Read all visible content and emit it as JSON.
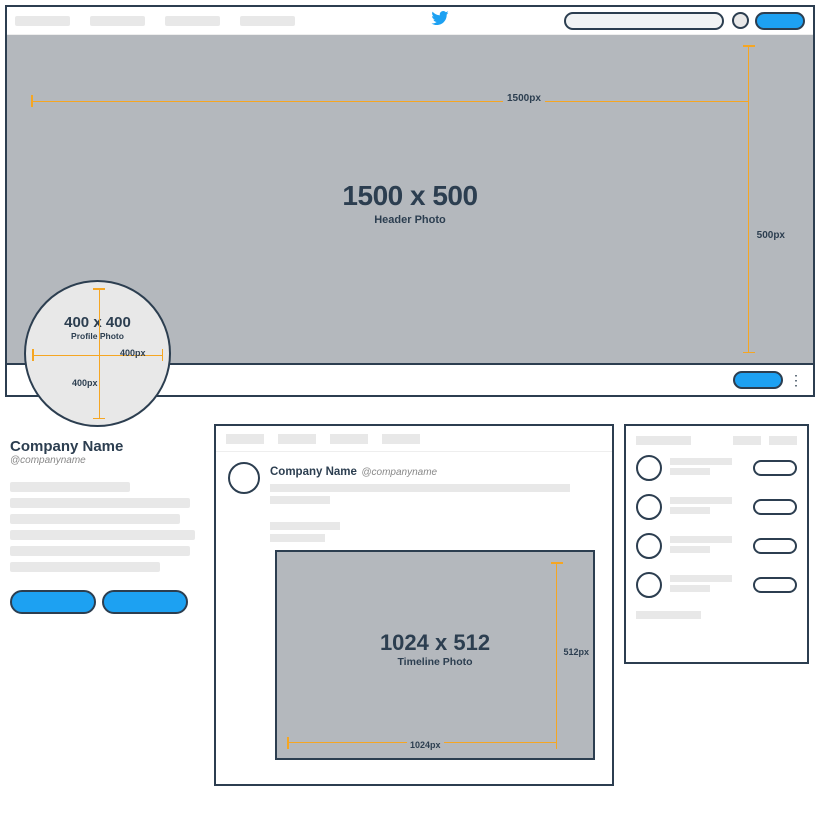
{
  "brand": "twitter",
  "header": {
    "size_label": "1500 x 500",
    "subtitle": "Header Photo",
    "width_px": "1500px",
    "height_px": "500px"
  },
  "profile": {
    "size_label": "400 x 400",
    "subtitle": "Profile Photo",
    "width_px": "400px",
    "height_px": "400px"
  },
  "company": {
    "name": "Company Name",
    "handle": "@companyname"
  },
  "post": {
    "name": "Company Name",
    "handle": "@companyname"
  },
  "timeline": {
    "size_label": "1024 x 512",
    "subtitle": "Timeline Photo",
    "width_px": "1024px",
    "height_px": "512px"
  }
}
